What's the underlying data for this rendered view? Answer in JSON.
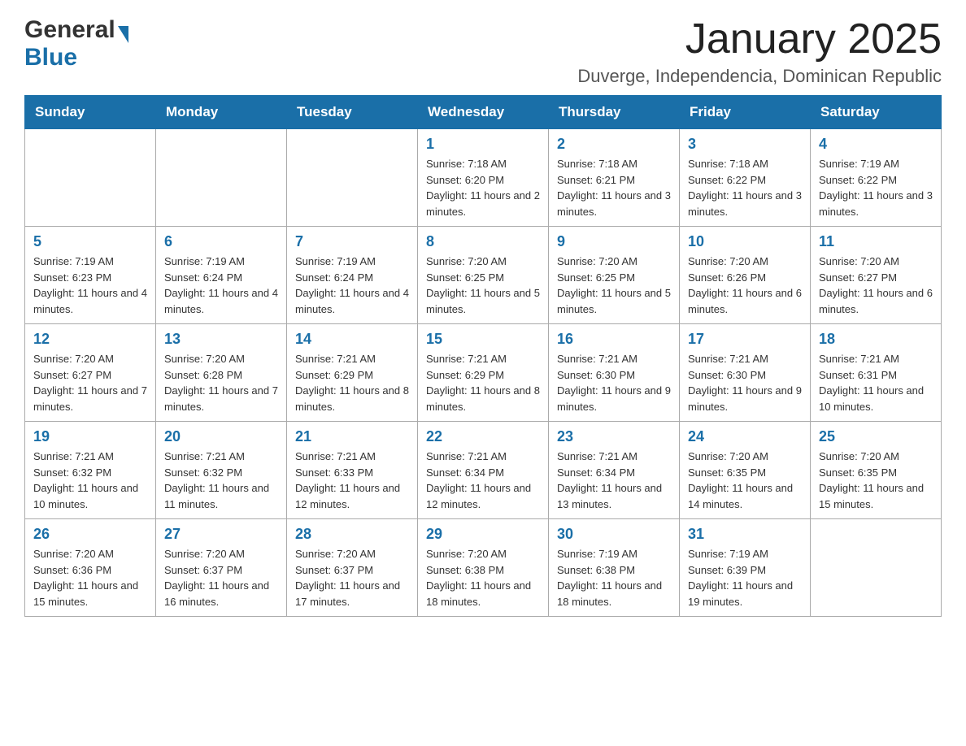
{
  "header": {
    "logo": {
      "general": "General",
      "blue": "Blue",
      "arrow": "▶"
    },
    "title": "January 2025",
    "location": "Duverge, Independencia, Dominican Republic"
  },
  "calendar": {
    "days_of_week": [
      "Sunday",
      "Monday",
      "Tuesday",
      "Wednesday",
      "Thursday",
      "Friday",
      "Saturday"
    ],
    "weeks": [
      {
        "days": [
          {
            "number": "",
            "info": ""
          },
          {
            "number": "",
            "info": ""
          },
          {
            "number": "",
            "info": ""
          },
          {
            "number": "1",
            "info": "Sunrise: 7:18 AM\nSunset: 6:20 PM\nDaylight: 11 hours and 2 minutes."
          },
          {
            "number": "2",
            "info": "Sunrise: 7:18 AM\nSunset: 6:21 PM\nDaylight: 11 hours and 3 minutes."
          },
          {
            "number": "3",
            "info": "Sunrise: 7:18 AM\nSunset: 6:22 PM\nDaylight: 11 hours and 3 minutes."
          },
          {
            "number": "4",
            "info": "Sunrise: 7:19 AM\nSunset: 6:22 PM\nDaylight: 11 hours and 3 minutes."
          }
        ]
      },
      {
        "days": [
          {
            "number": "5",
            "info": "Sunrise: 7:19 AM\nSunset: 6:23 PM\nDaylight: 11 hours and 4 minutes."
          },
          {
            "number": "6",
            "info": "Sunrise: 7:19 AM\nSunset: 6:24 PM\nDaylight: 11 hours and 4 minutes."
          },
          {
            "number": "7",
            "info": "Sunrise: 7:19 AM\nSunset: 6:24 PM\nDaylight: 11 hours and 4 minutes."
          },
          {
            "number": "8",
            "info": "Sunrise: 7:20 AM\nSunset: 6:25 PM\nDaylight: 11 hours and 5 minutes."
          },
          {
            "number": "9",
            "info": "Sunrise: 7:20 AM\nSunset: 6:25 PM\nDaylight: 11 hours and 5 minutes."
          },
          {
            "number": "10",
            "info": "Sunrise: 7:20 AM\nSunset: 6:26 PM\nDaylight: 11 hours and 6 minutes."
          },
          {
            "number": "11",
            "info": "Sunrise: 7:20 AM\nSunset: 6:27 PM\nDaylight: 11 hours and 6 minutes."
          }
        ]
      },
      {
        "days": [
          {
            "number": "12",
            "info": "Sunrise: 7:20 AM\nSunset: 6:27 PM\nDaylight: 11 hours and 7 minutes."
          },
          {
            "number": "13",
            "info": "Sunrise: 7:20 AM\nSunset: 6:28 PM\nDaylight: 11 hours and 7 minutes."
          },
          {
            "number": "14",
            "info": "Sunrise: 7:21 AM\nSunset: 6:29 PM\nDaylight: 11 hours and 8 minutes."
          },
          {
            "number": "15",
            "info": "Sunrise: 7:21 AM\nSunset: 6:29 PM\nDaylight: 11 hours and 8 minutes."
          },
          {
            "number": "16",
            "info": "Sunrise: 7:21 AM\nSunset: 6:30 PM\nDaylight: 11 hours and 9 minutes."
          },
          {
            "number": "17",
            "info": "Sunrise: 7:21 AM\nSunset: 6:30 PM\nDaylight: 11 hours and 9 minutes."
          },
          {
            "number": "18",
            "info": "Sunrise: 7:21 AM\nSunset: 6:31 PM\nDaylight: 11 hours and 10 minutes."
          }
        ]
      },
      {
        "days": [
          {
            "number": "19",
            "info": "Sunrise: 7:21 AM\nSunset: 6:32 PM\nDaylight: 11 hours and 10 minutes."
          },
          {
            "number": "20",
            "info": "Sunrise: 7:21 AM\nSunset: 6:32 PM\nDaylight: 11 hours and 11 minutes."
          },
          {
            "number": "21",
            "info": "Sunrise: 7:21 AM\nSunset: 6:33 PM\nDaylight: 11 hours and 12 minutes."
          },
          {
            "number": "22",
            "info": "Sunrise: 7:21 AM\nSunset: 6:34 PM\nDaylight: 11 hours and 12 minutes."
          },
          {
            "number": "23",
            "info": "Sunrise: 7:21 AM\nSunset: 6:34 PM\nDaylight: 11 hours and 13 minutes."
          },
          {
            "number": "24",
            "info": "Sunrise: 7:20 AM\nSunset: 6:35 PM\nDaylight: 11 hours and 14 minutes."
          },
          {
            "number": "25",
            "info": "Sunrise: 7:20 AM\nSunset: 6:35 PM\nDaylight: 11 hours and 15 minutes."
          }
        ]
      },
      {
        "days": [
          {
            "number": "26",
            "info": "Sunrise: 7:20 AM\nSunset: 6:36 PM\nDaylight: 11 hours and 15 minutes."
          },
          {
            "number": "27",
            "info": "Sunrise: 7:20 AM\nSunset: 6:37 PM\nDaylight: 11 hours and 16 minutes."
          },
          {
            "number": "28",
            "info": "Sunrise: 7:20 AM\nSunset: 6:37 PM\nDaylight: 11 hours and 17 minutes."
          },
          {
            "number": "29",
            "info": "Sunrise: 7:20 AM\nSunset: 6:38 PM\nDaylight: 11 hours and 18 minutes."
          },
          {
            "number": "30",
            "info": "Sunrise: 7:19 AM\nSunset: 6:38 PM\nDaylight: 11 hours and 18 minutes."
          },
          {
            "number": "31",
            "info": "Sunrise: 7:19 AM\nSunset: 6:39 PM\nDaylight: 11 hours and 19 minutes."
          },
          {
            "number": "",
            "info": ""
          }
        ]
      }
    ]
  }
}
